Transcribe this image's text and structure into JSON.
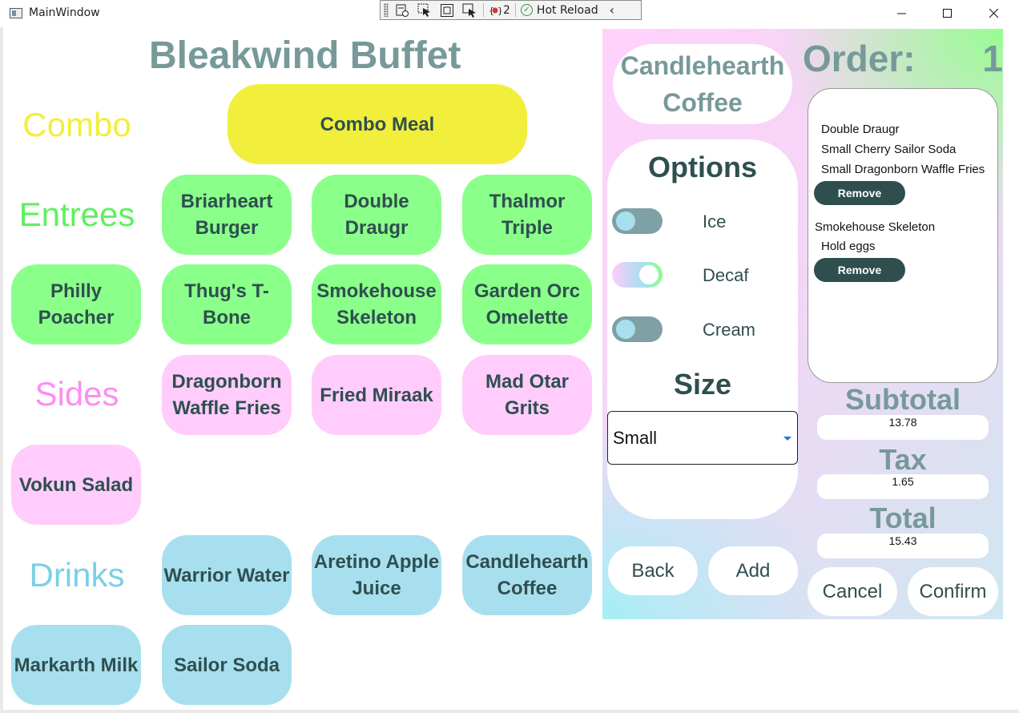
{
  "window": {
    "title": "MainWindow"
  },
  "debug_toolbar": {
    "count": "2",
    "hot_reload": "Hot Reload"
  },
  "app_title": "Bleakwind Buffet",
  "categories": {
    "combo": {
      "label": "Combo",
      "color": "#f2ee3c"
    },
    "entrees": {
      "label": "Entrees",
      "color": "#5ef05e"
    },
    "sides": {
      "label": "Sides",
      "color": "#ff8cf2"
    },
    "drinks": {
      "label": "Drinks",
      "color": "#7bd0e6"
    }
  },
  "menu": {
    "combo": [
      "Combo Meal"
    ],
    "entrees": [
      "Briarheart Burger",
      "Double Draugr",
      "Thalmor Triple",
      "Philly Poacher",
      "Thug's T-Bone",
      "Smokehouse Skeleton",
      "Garden Orc Omelette"
    ],
    "sides": [
      "Dragonborn Waffle Fries",
      "Fried Miraak",
      "Mad Otar Grits",
      "Vokun Salad"
    ],
    "drinks": [
      "Warrior Water",
      "Aretino Apple Juice",
      "Candlehearth Coffee",
      "Markarth Milk",
      "Sailor Soda"
    ]
  },
  "customize": {
    "item_name": "Candlehearth Coffee",
    "options_title": "Options",
    "options": [
      {
        "label": "Ice",
        "on": false
      },
      {
        "label": "Decaf",
        "on": true
      },
      {
        "label": "Cream",
        "on": false
      }
    ],
    "size_title": "Size",
    "size_value": "Small",
    "back_label": "Back",
    "add_label": "Add"
  },
  "order": {
    "title": "Order:",
    "number": "1",
    "combo_lines": [
      "Double Draugr",
      "Small Cherry Sailor Soda",
      "Small Dragonborn Waffle Fries"
    ],
    "item_name": "Smokehouse Skeleton",
    "item_special": "Hold eggs",
    "remove_label": "Remove",
    "subtotal_label": "Subtotal",
    "subtotal": "13.78",
    "tax_label": "Tax",
    "tax": "1.65",
    "total_label": "Total",
    "total": "15.43",
    "cancel_label": "Cancel",
    "confirm_label": "Confirm"
  }
}
